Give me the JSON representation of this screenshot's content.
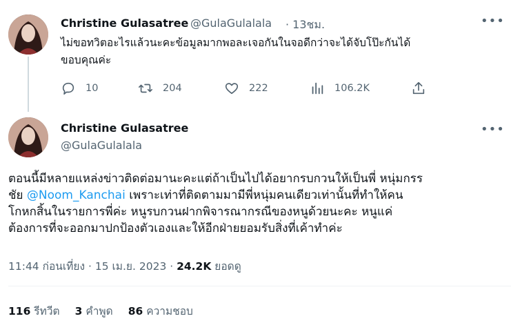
{
  "reply": {
    "name": "Christine Gulasatree",
    "handle": "@GulaGulalala",
    "time": "· 13ชม.",
    "text_line1": "ไม่ขอทวิตอะไรแล้วนะคะข้อมูลมากพอละเจอกันในจอดีกว่าจะได้จับโป๊ะกันได้",
    "text_line2": "ขอบคุณค่ะ",
    "replies": "10",
    "retweets": "204",
    "likes": "222",
    "views": "106.2K"
  },
  "main": {
    "name": "Christine Gulasatree",
    "handle": "@GulaGulalala",
    "line1": "ตอนนี้มีหลายแหล่งข่าวติดต่อมานะคะแต่ถ้าเป็นไปได้อยากรบกวนให้เป็นพี่ หนุ่มกรร",
    "line2_pre": "ชัย ",
    "mention": "@Noom_Kanchai",
    "line2_post": " เพราะเท่าที่ติดตามมามีพี่หนุ่มคนเดียวเท่านั้นที่ทำให้คน",
    "line3": "โกหกสิ้นในรายการพี่ค่ะ หนูรบกวนฝากพิจารณากรณีของหนูด้วยนะคะ หนูแค่",
    "line4": "ต้องการที่จะออกมาปกป้องตัวเองและให้อีกฝ่ายยอมรับสิ่งที่เค้าทำค่ะ",
    "timestamp": "11:44 ก่อนเที่ยง · 15 เม.ย. 2023 · ",
    "views_count": "24.2K",
    "views_label": " ยอดดู",
    "retweets_count": "116",
    "retweets_label": "รีทวีต",
    "quotes_count": "3",
    "quotes_label": "คำพูด",
    "likes_count": "86",
    "likes_label": "ความชอบ"
  },
  "icons": {
    "reply": "comment-icon",
    "retweet": "retweet-icon",
    "like": "heart-icon",
    "views": "bar-chart-icon",
    "share": "share-icon",
    "more": "more-icon"
  },
  "colors": {
    "text": "#0f1419",
    "secondary": "#536471",
    "link": "#1d9bf0"
  }
}
